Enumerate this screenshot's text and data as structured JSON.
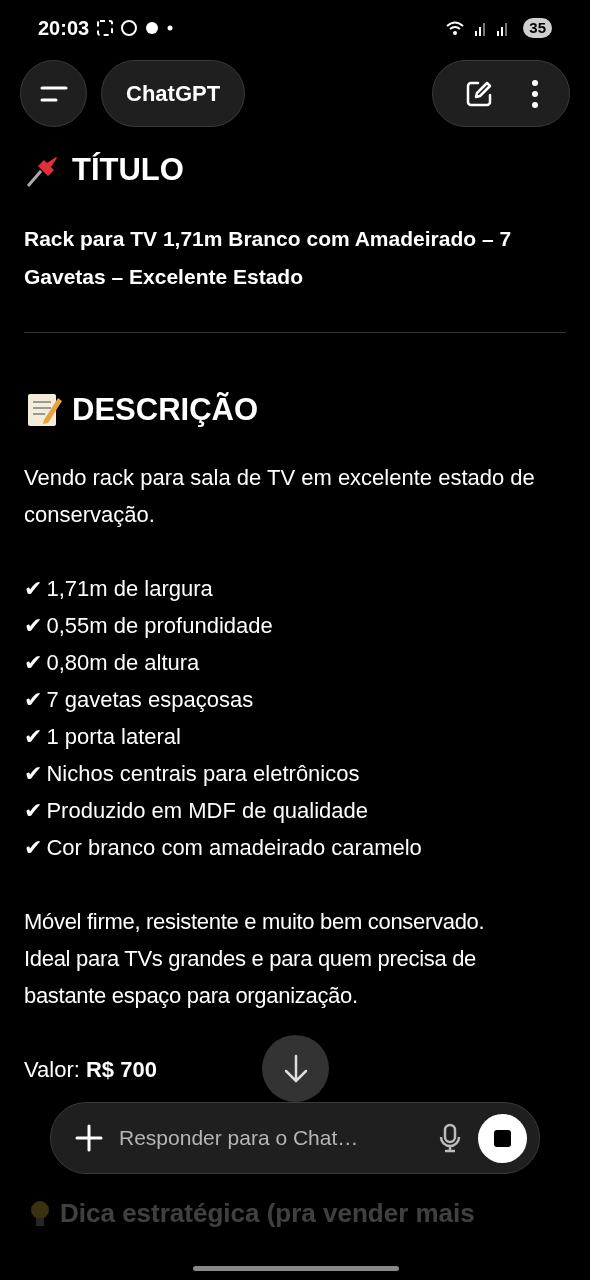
{
  "status_bar": {
    "time": "20:03",
    "battery": "35"
  },
  "header": {
    "title": "ChatGPT"
  },
  "sections": [
    {
      "kind": "pin",
      "heading": "TÍTULO"
    },
    {
      "kind": "memo",
      "heading": "DESCRIÇÃO"
    }
  ],
  "product_title": "Rack para TV 1,71m Branco com Amadeirado – 7 Gavetas – Excelente Estado",
  "intro": "Vendo rack para sala de TV em excelente estado de conservação.",
  "features": [
    {
      "mark": "✔",
      "text": "1,71m de largura"
    },
    {
      "mark": "✔",
      "text": "0,55m de profundidade"
    },
    {
      "mark": "✔",
      "text": "0,80m de altura"
    },
    {
      "mark": "✔",
      "text": "7 gavetas espaçosas"
    },
    {
      "mark": "✔",
      "text": "1 porta lateral"
    },
    {
      "mark": "✔",
      "text": "Nichos centrais para eletrônicos"
    },
    {
      "mark": "✔",
      "text": "Produzido em MDF de qualidade"
    },
    {
      "mark": "✔",
      "text": "Cor branco com amadeirado caramelo"
    }
  ],
  "closing": "Móvel firme, resistente e muito bem conservado. Ideal para TVs grandes e para quem precisa de bastante espaço para organização.",
  "price": "Valor: **R$ 700**",
  "composer": {
    "placeholder": "Responder para o Chat…"
  },
  "next_heading": "Dica estratégica (pra vender mais"
}
